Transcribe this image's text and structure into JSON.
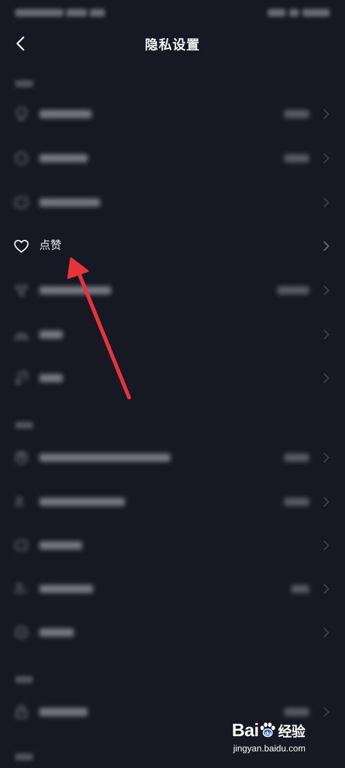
{
  "header": {
    "title": "隐私设置"
  },
  "rows": {
    "likes": {
      "label": "点赞"
    }
  },
  "watermark": {
    "brand_left": "Bai",
    "brand_right": "经验",
    "url": "jingyan.baidu.com"
  },
  "colors": {
    "background": "#161823",
    "text_primary": "#eeeef0",
    "text_secondary": "#9a9ba3",
    "annotation_arrow": "#e8333a"
  },
  "icons": {
    "back": "chevron-left-icon",
    "likes": "heart-outline-icon",
    "row_chevron": "chevron-right-icon"
  }
}
